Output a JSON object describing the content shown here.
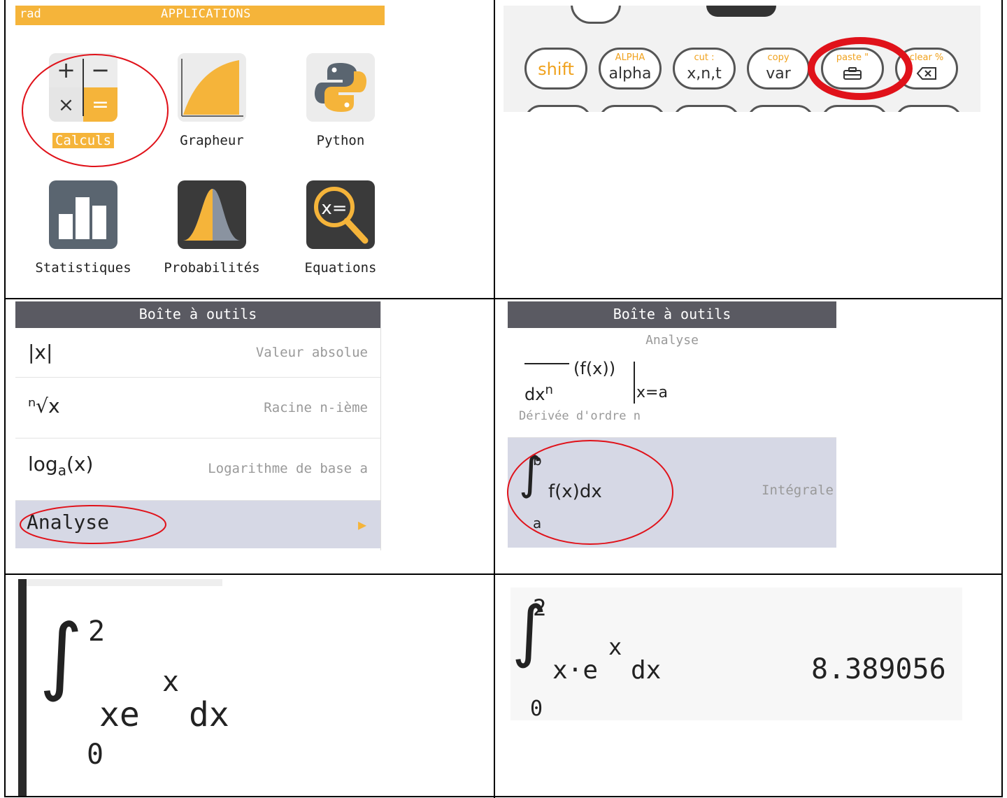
{
  "apps": {
    "status": "rad",
    "title": "APPLICATIONS",
    "items": [
      {
        "label": "Calculs",
        "icon": "calculator-icon"
      },
      {
        "label": "Grapheur",
        "icon": "grapher-icon"
      },
      {
        "label": "Python",
        "icon": "python-icon"
      },
      {
        "label": "Statistiques",
        "icon": "statistics-icon"
      },
      {
        "label": "Probabilités",
        "icon": "probability-icon"
      },
      {
        "label": "Equations",
        "icon": "equations-icon"
      }
    ]
  },
  "keyboard": {
    "keys": [
      {
        "sup": "",
        "main": "shift"
      },
      {
        "sup": "ALPHA",
        "main": "alpha"
      },
      {
        "sup": "cut   :",
        "main": "x,n,t"
      },
      {
        "sup": "copy",
        "main": "var"
      },
      {
        "sup": "paste \"",
        "main": "toolbox-icon"
      },
      {
        "sup": "clear %",
        "main": "backspace-icon"
      }
    ]
  },
  "toolbox": {
    "title": "Boîte à outils",
    "rows": [
      {
        "symbol": "|x|",
        "desc": "Valeur absolue"
      },
      {
        "symbol": "ⁿ√x",
        "desc": "Racine n-ième"
      },
      {
        "symbol": "log_a(x)",
        "desc": "Logarithme de base a"
      },
      {
        "symbol": "Analyse",
        "desc": ""
      }
    ]
  },
  "analysis": {
    "title": "Boîte à outils",
    "subtitle": "Analyse",
    "derivative_label": "Dérivée d'ordre n",
    "integral_label": "Intégrale"
  },
  "input_expr": {
    "upper": "2",
    "lower": "0",
    "integrand": "xe",
    "exp": "x",
    "d": "dx"
  },
  "result_expr": {
    "upper": "2",
    "lower": "0",
    "integrand": "x·e",
    "exp": "x",
    "d": "dx",
    "value": "8.389056"
  },
  "colors": {
    "accent": "#f5b43a",
    "highlight": "#d6d8e5",
    "annotation": "#e0121a"
  }
}
